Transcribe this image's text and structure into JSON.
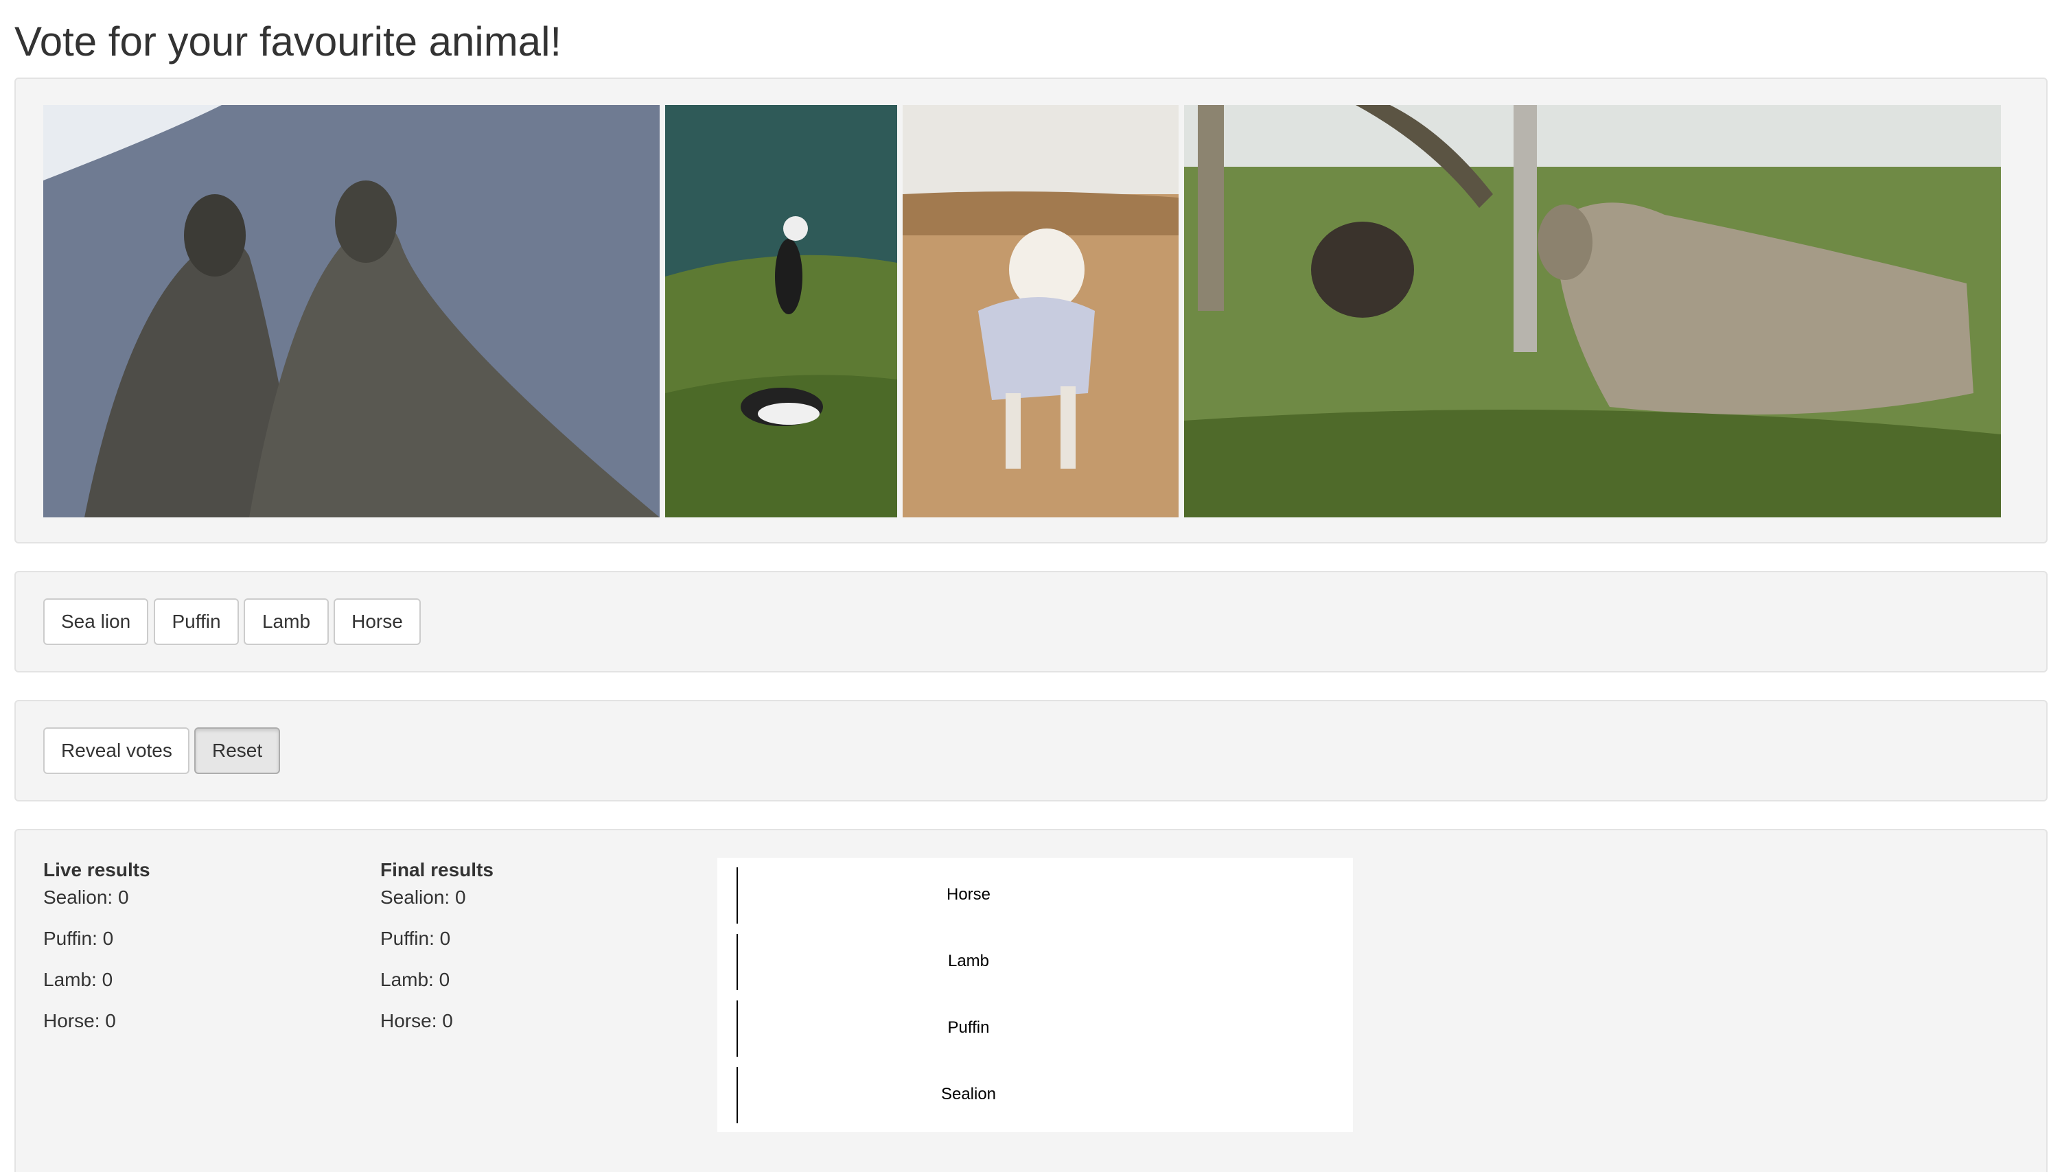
{
  "page": {
    "title": "Vote for your favourite animal!"
  },
  "images": [
    {
      "animal": "Sea lion",
      "icon": "sealion-photo"
    },
    {
      "animal": "Puffin",
      "icon": "puffin-photo"
    },
    {
      "animal": "Lamb",
      "icon": "lamb-photo"
    },
    {
      "animal": "Horse",
      "icon": "horse-photo"
    }
  ],
  "vote": {
    "buttons": [
      "Sea lion",
      "Puffin",
      "Lamb",
      "Horse"
    ]
  },
  "admin": {
    "reveal_label": "Reveal votes",
    "reset_label": "Reset"
  },
  "results": {
    "live_heading": "Live results",
    "final_heading": "Final results",
    "live": [
      "Sealion: 0",
      "Puffin: 0",
      "Lamb: 0",
      "Horse: 0"
    ],
    "final": [
      "Sealion: 0",
      "Puffin: 0",
      "Lamb: 0",
      "Horse: 0"
    ]
  },
  "chart_data": {
    "type": "bar",
    "orientation": "horizontal",
    "categories": [
      "Horse",
      "Lamb",
      "Puffin",
      "Sealion"
    ],
    "values": [
      0,
      0,
      0,
      0
    ],
    "title": "",
    "xlabel": "",
    "ylabel": ""
  },
  "colors": {
    "panel": "#f4f4f4",
    "panel_border": "#e3e3e3",
    "button_border": "#cccccc"
  }
}
